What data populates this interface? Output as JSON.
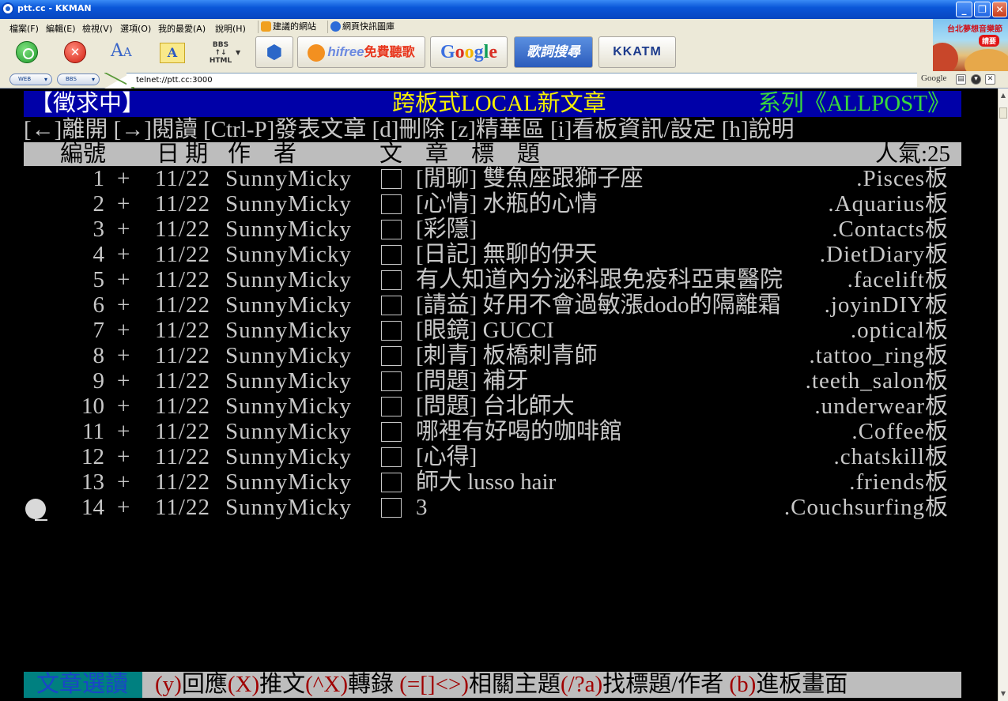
{
  "window": {
    "title": "ptt.cc - KKMAN",
    "minimize": "_",
    "restore": "❐",
    "close": "✕"
  },
  "menubar": {
    "items": [
      "檔案(F)",
      "編輯(E)",
      "檢視(V)",
      "選項(O)",
      "我的最愛(A)",
      "說明(H)"
    ],
    "links": [
      "建議的網站",
      "網頁快訊圖庫"
    ]
  },
  "toolbar": {
    "stop_glyph": "✕",
    "font_big": "A",
    "font_small": "A",
    "font_btn2": "A",
    "bbs_html": [
      "BBS",
      "↑↓",
      "HTML"
    ],
    "hifree_main": "hifree",
    "hifree_sub": "免費聽歌",
    "google": "Google",
    "lyric": "歌詞搜尋",
    "kkatm": "KKATM"
  },
  "ad": {
    "text": "台北夢想音樂節",
    "button": "請要"
  },
  "address": {
    "mode1": "WEB",
    "mode2": "BBS",
    "url": "telnet://ptt.cc:3000",
    "search_label": "Google"
  },
  "terminal": {
    "header_mode": "【徵求中】",
    "header_title": "跨板式LOCAL新文章",
    "header_series": "系列《ALLPOST》",
    "help_line": "[←]離開 [→]閱讀 [Ctrl-P]發表文章 [d]刪除 [z]精華區 [i]看板資訊/設定 [h]說明",
    "columns": {
      "num": "編號",
      "date": "日 期",
      "author": "作　者",
      "title": "文　章　標　題",
      "popularity": "人氣:25"
    },
    "rows": [
      {
        "num": "1",
        "mark": "+",
        "date": "11/22",
        "author": "SunnyMicky",
        "title": "[閒聊] 雙魚座跟獅子座",
        "board": ".Pisces板"
      },
      {
        "num": "2",
        "mark": "+",
        "date": "11/22",
        "author": "SunnyMicky",
        "title": "[心情] 水瓶的心情",
        "board": ".Aquarius板"
      },
      {
        "num": "3",
        "mark": "+",
        "date": "11/22",
        "author": "SunnyMicky",
        "title": "[彩隱]",
        "board": ".Contacts板"
      },
      {
        "num": "4",
        "mark": "+",
        "date": "11/22",
        "author": "SunnyMicky",
        "title": "[日記] 無聊的伊天",
        "board": ".DietDiary板"
      },
      {
        "num": "5",
        "mark": "+",
        "date": "11/22",
        "author": "SunnyMicky",
        "title": "有人知道內分泌科跟免疫科亞東醫院",
        "board": ".facelift板"
      },
      {
        "num": "6",
        "mark": "+",
        "date": "11/22",
        "author": "SunnyMicky",
        "title": "[請益] 好用不會過敏漲dodo的隔離霜",
        "board": ".joyinDIY板"
      },
      {
        "num": "7",
        "mark": "+",
        "date": "11/22",
        "author": "SunnyMicky",
        "title": "[眼鏡] GUCCI",
        "board": ".optical板"
      },
      {
        "num": "8",
        "mark": "+",
        "date": "11/22",
        "author": "SunnyMicky",
        "title": "[刺青] 板橋刺青師",
        "board": ".tattoo_ring板"
      },
      {
        "num": "9",
        "mark": "+",
        "date": "11/22",
        "author": "SunnyMicky",
        "title": "[問題] 補牙",
        "board": ".teeth_salon板"
      },
      {
        "num": "10",
        "mark": "+",
        "date": "11/22",
        "author": "SunnyMicky",
        "title": "[問題] 台北師大",
        "board": ".underwear板"
      },
      {
        "num": "11",
        "mark": "+",
        "date": "11/22",
        "author": "SunnyMicky",
        "title": "哪裡有好喝的咖啡館",
        "board": ".Coffee板"
      },
      {
        "num": "12",
        "mark": "+",
        "date": "11/22",
        "author": "SunnyMicky",
        "title": "[心得]",
        "board": ".chatskill板"
      },
      {
        "num": "13",
        "mark": "+",
        "date": "11/22",
        "author": "SunnyMicky",
        "title": "師大 lusso hair",
        "board": ".friends板"
      },
      {
        "num": "14",
        "mark": "+",
        "date": "11/22",
        "author": "SunnyMicky",
        "title": "3",
        "board": ".Couchsurfing板"
      }
    ],
    "footer_mode": "文章選讀",
    "footer_help": [
      {
        "k": "(y)",
        "t": "回應"
      },
      {
        "k": "(X)",
        "t": "推文"
      },
      {
        "k": "(^X)",
        "t": "轉錄 "
      },
      {
        "k": "(=[]<>)",
        "t": "相關主題"
      },
      {
        "k": "(/?a)",
        "t": "找標題/作者 "
      },
      {
        "k": "(b)",
        "t": "進板畫面"
      }
    ]
  }
}
